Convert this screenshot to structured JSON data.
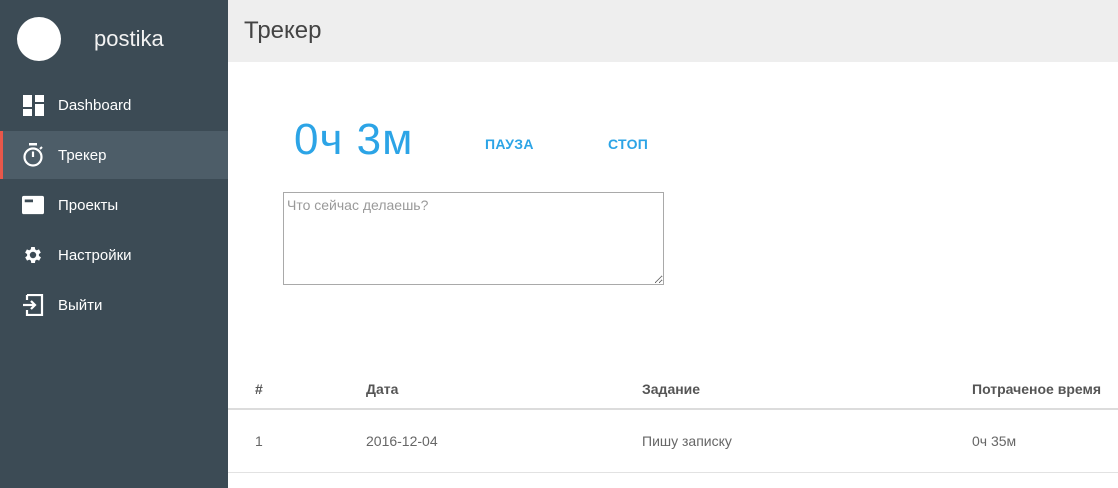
{
  "brand": {
    "name": "postika"
  },
  "sidebar": {
    "items": [
      {
        "label": "Dashboard",
        "icon": "dashboard-icon",
        "active": false
      },
      {
        "label": "Трекер",
        "icon": "stopwatch-icon",
        "active": true
      },
      {
        "label": "Проекты",
        "icon": "folder-card-icon",
        "active": false
      },
      {
        "label": "Настройки",
        "icon": "gear-icon",
        "active": false
      },
      {
        "label": "Выйти",
        "icon": "logout-icon",
        "active": false
      }
    ]
  },
  "header": {
    "title": "Трекер"
  },
  "tracker": {
    "elapsed": "0ч 3м",
    "pause_label": "ПАУЗА",
    "stop_label": "СТОП",
    "task_placeholder": "Что сейчас делаешь?",
    "task_value": ""
  },
  "table": {
    "columns": [
      "#",
      "Дата",
      "Задание",
      "Потраченое время"
    ],
    "rows": [
      {
        "num": "1",
        "date": "2016-12-04",
        "task": "Пишу записку",
        "time": "0ч 35м"
      }
    ]
  },
  "colors": {
    "sidebar_bg": "#3c4b55",
    "sidebar_active_bg": "#4d5d68",
    "active_marker": "#e8574a",
    "accent": "#2ca4e6",
    "header_bg": "#eeeeee"
  }
}
